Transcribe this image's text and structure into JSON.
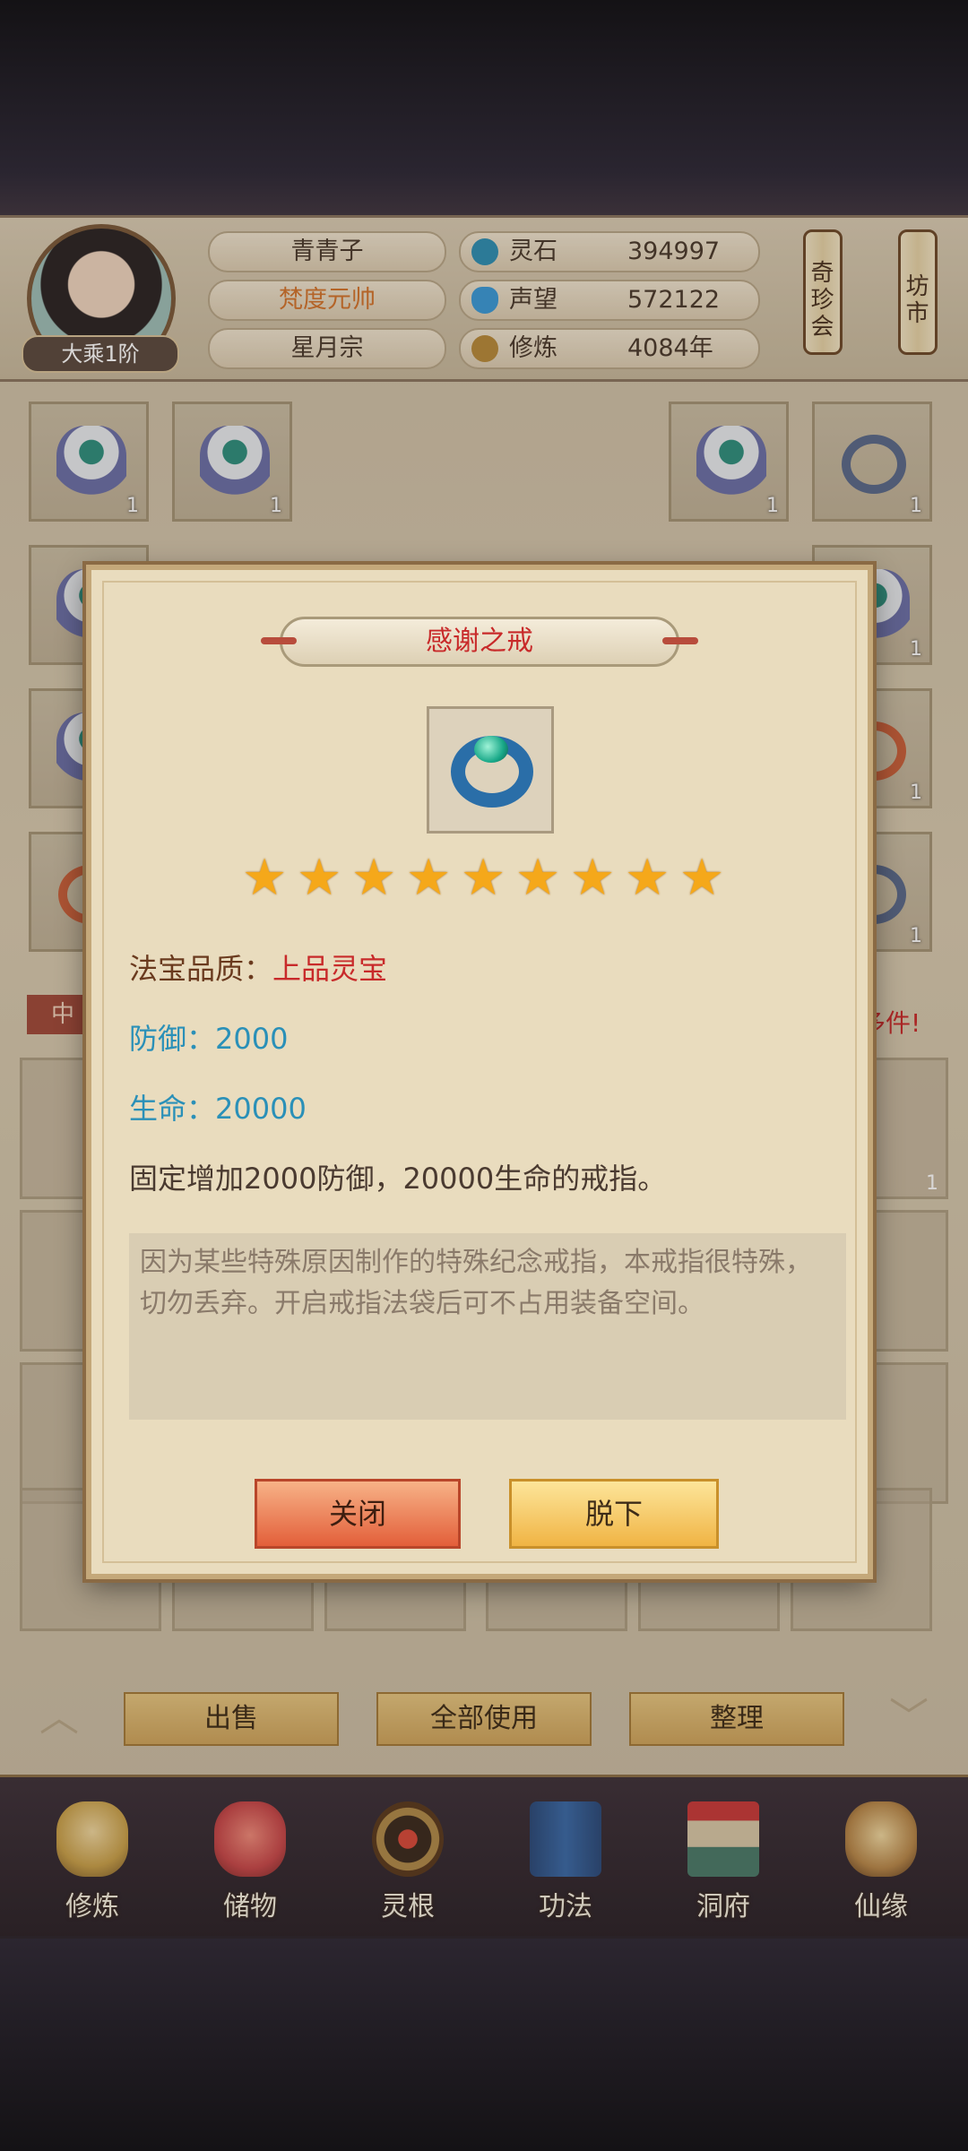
{
  "player": {
    "name": "青青子",
    "title": "梵度元帅",
    "sect": "星月宗",
    "realm": "大乘1阶"
  },
  "resources": [
    {
      "icon": "spirit-stone-icon",
      "label": "灵石",
      "value": "394997",
      "color": "#2e8fb4"
    },
    {
      "icon": "reputation-icon",
      "label": "声望",
      "value": "572122",
      "color": "#3a9ad8"
    },
    {
      "icon": "cultivation-icon",
      "label": "修炼",
      "value": "4084年",
      "color": "#b88a3a"
    }
  ],
  "side_buttons": [
    {
      "label": "奇珍会"
    },
    {
      "label": "坊市"
    }
  ],
  "inventory": {
    "item_qty": "1",
    "tag_label": "中",
    "side_message": "多件!"
  },
  "modal": {
    "title": "感谢之戒",
    "icon": "jade-ring-icon",
    "stars": 9,
    "star_glyph": "★",
    "quality_label": "法宝品质：",
    "quality_value": "上品灵宝",
    "defense": "防御：2000",
    "life": "生命：20000",
    "effect": "固定增加2000防御，20000生命的戒指。",
    "lore": "因为某些特殊原因制作的特殊纪念戒指，本戒指很特殊，切勿丢弃。开启戒指法袋后可不占用装备空间。",
    "close_label": "关闭",
    "unequip_label": "脱下"
  },
  "actions": {
    "sell": "出售",
    "use_all": "全部使用",
    "sort": "整理"
  },
  "nav": [
    {
      "label": "修炼",
      "icon": "cultivate-icon",
      "color": "#c9a14a"
    },
    {
      "label": "储物",
      "icon": "storage-bag-icon",
      "color": "#c8484a"
    },
    {
      "label": "灵根",
      "icon": "spirit-root-icon",
      "color": "#8a5a2a"
    },
    {
      "label": "功法",
      "icon": "technique-book-icon",
      "color": "#3a6aa8"
    },
    {
      "label": "洞府",
      "icon": "cave-mansion-icon",
      "color": "#7a5a48"
    },
    {
      "label": "仙缘",
      "icon": "immortal-fate-icon",
      "color": "#b8884a"
    }
  ]
}
